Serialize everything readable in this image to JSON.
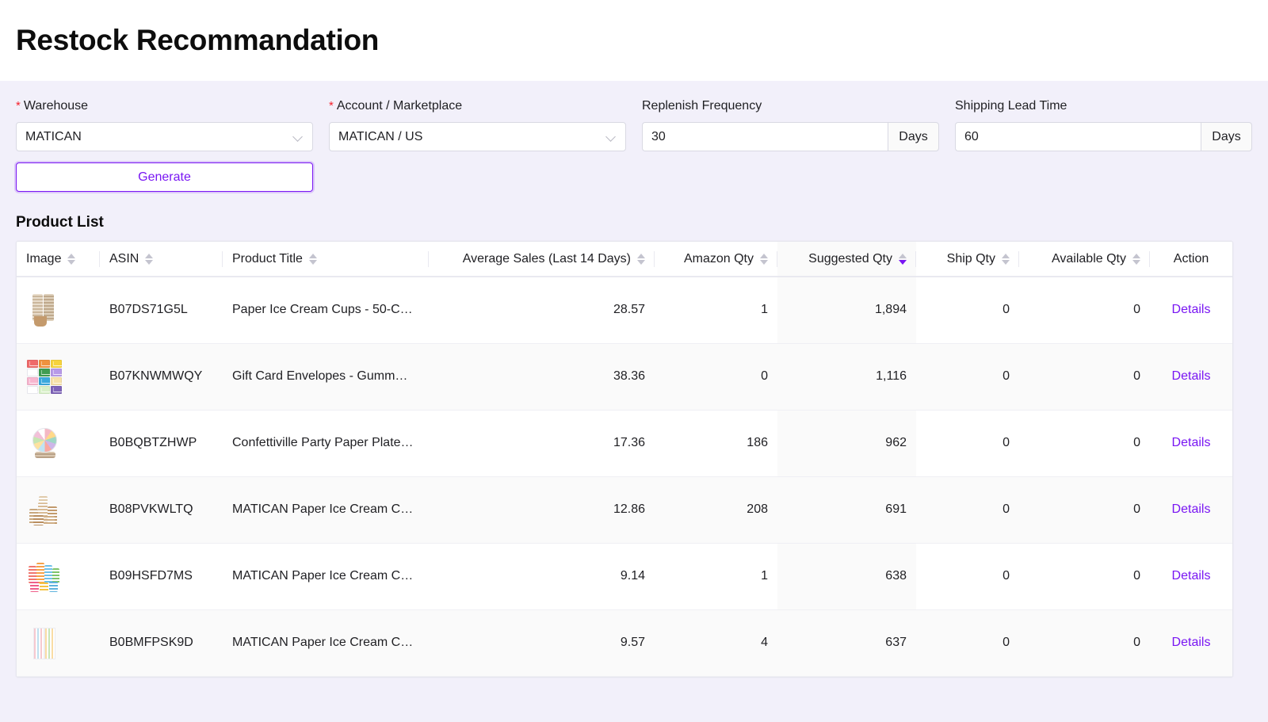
{
  "header": {
    "title": "Restock Recommandation"
  },
  "filters": {
    "warehouse": {
      "label": "Warehouse",
      "required": true,
      "value": "MATICAN"
    },
    "account": {
      "label": "Account / Marketplace",
      "required": true,
      "value": "MATICAN / US"
    },
    "replenish": {
      "label": "Replenish Frequency",
      "required": false,
      "value": "30",
      "unit": "Days"
    },
    "shipping": {
      "label": "Shipping Lead Time",
      "required": false,
      "value": "60",
      "unit": "Days"
    },
    "generate_label": "Generate"
  },
  "product_list": {
    "section_title": "Product List",
    "columns": [
      {
        "key": "image",
        "label": "Image",
        "align": "left",
        "sortable": true,
        "sorted": "none"
      },
      {
        "key": "asin",
        "label": "ASIN",
        "align": "left",
        "sortable": true,
        "sorted": "none"
      },
      {
        "key": "title",
        "label": "Product Title",
        "align": "left",
        "sortable": true,
        "sorted": "none"
      },
      {
        "key": "avg_sales",
        "label": "Average Sales (Last 14 Days)",
        "align": "right",
        "sortable": true,
        "sorted": "none"
      },
      {
        "key": "amazon_qty",
        "label": "Amazon Qty",
        "align": "right",
        "sortable": true,
        "sorted": "none"
      },
      {
        "key": "suggested_qty",
        "label": "Suggested Qty",
        "align": "right",
        "sortable": true,
        "sorted": "desc"
      },
      {
        "key": "ship_qty",
        "label": "Ship Qty",
        "align": "right",
        "sortable": true,
        "sorted": "none"
      },
      {
        "key": "available_qty",
        "label": "Available Qty",
        "align": "right",
        "sortable": true,
        "sorted": "none"
      },
      {
        "key": "action",
        "label": "Action",
        "align": "center",
        "sortable": false,
        "sorted": "none"
      }
    ],
    "rows": [
      {
        "image": "paper-ice-cream-cups-thumbnail",
        "asin": "B07DS71G5L",
        "title": "Paper Ice Cream Cups - 50-C…",
        "avg_sales": "28.57",
        "amazon_qty": "1",
        "suggested_qty": "1,894",
        "ship_qty": "0",
        "available_qty": "0",
        "action": "Details"
      },
      {
        "image": "gift-card-envelopes-thumbnail",
        "asin": "B07KNWMWQY",
        "title": "Gift Card Envelopes - Gumm…",
        "avg_sales": "38.36",
        "amazon_qty": "0",
        "suggested_qty": "1,116",
        "ship_qty": "0",
        "available_qty": "0",
        "action": "Details"
      },
      {
        "image": "confetti-party-plate-thumbnail",
        "asin": "B0BQBTZHWP",
        "title": "Confettiville Party Paper Plate…",
        "avg_sales": "17.36",
        "amazon_qty": "186",
        "suggested_qty": "962",
        "ship_qty": "0",
        "available_qty": "0",
        "action": "Details"
      },
      {
        "image": "kraft-cup-pile-thumbnail",
        "asin": "B08PVKWLTQ",
        "title": "MATICAN Paper Ice Cream C…",
        "avg_sales": "12.86",
        "amazon_qty": "208",
        "suggested_qty": "691",
        "ship_qty": "0",
        "available_qty": "0",
        "action": "Details"
      },
      {
        "image": "colorful-cup-stacks-thumbnail",
        "asin": "B09HSFD7MS",
        "title": "MATICAN Paper Ice Cream C…",
        "avg_sales": "9.14",
        "amazon_qty": "1",
        "suggested_qty": "638",
        "ship_qty": "0",
        "available_qty": "0",
        "action": "Details"
      },
      {
        "image": "striped-cups-thumbnail",
        "asin": "B0BMFPSK9D",
        "title": "MATICAN Paper Ice Cream C…",
        "avg_sales": "9.57",
        "amazon_qty": "4",
        "suggested_qty": "637",
        "ship_qty": "0",
        "available_qty": "0",
        "action": "Details"
      }
    ]
  },
  "colors": {
    "accent": "#7916f3",
    "page_bg": "#f2f0fa",
    "required_star": "#f5222d",
    "text": "#1f1f23",
    "sorted_column_bg": "#fafafa"
  }
}
